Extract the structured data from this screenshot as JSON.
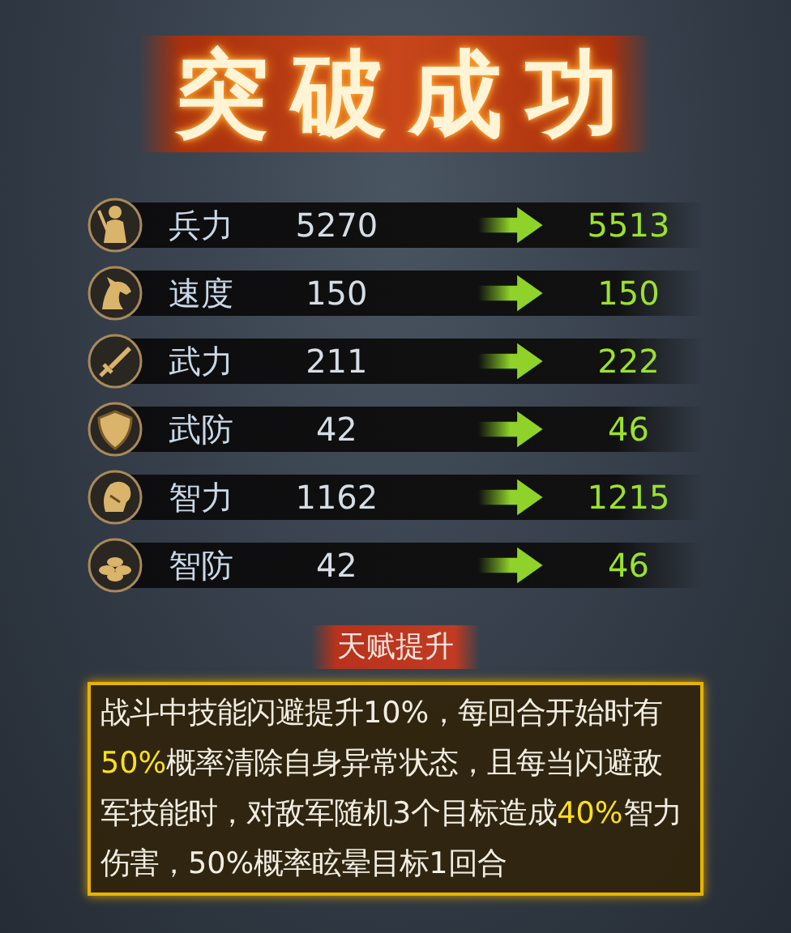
{
  "title": "突破成功",
  "stats": [
    {
      "label": "兵力",
      "before": "5270",
      "after": "5513"
    },
    {
      "label": "速度",
      "before": "150",
      "after": "150"
    },
    {
      "label": "武力",
      "before": "211",
      "after": "222"
    },
    {
      "label": "武防",
      "before": "42",
      "after": "46"
    },
    {
      "label": "智力",
      "before": "1162",
      "after": "1215"
    },
    {
      "label": "智防",
      "before": "42",
      "after": "46"
    }
  ],
  "talent": {
    "heading": "天赋提升",
    "description": [
      {
        "text": "战斗中技能闪避提升10%，每回合开始时有",
        "highlight": false
      },
      {
        "text": "50%",
        "highlight": true
      },
      {
        "text": "概率清除自身异常状态，且每当闪避敌军技能时，对敌军随机3个目标造成",
        "highlight": false
      },
      {
        "text": "40%",
        "highlight": true
      },
      {
        "text": "智力伤害，50%概率眩晕目标1回合",
        "highlight": false
      }
    ]
  }
}
